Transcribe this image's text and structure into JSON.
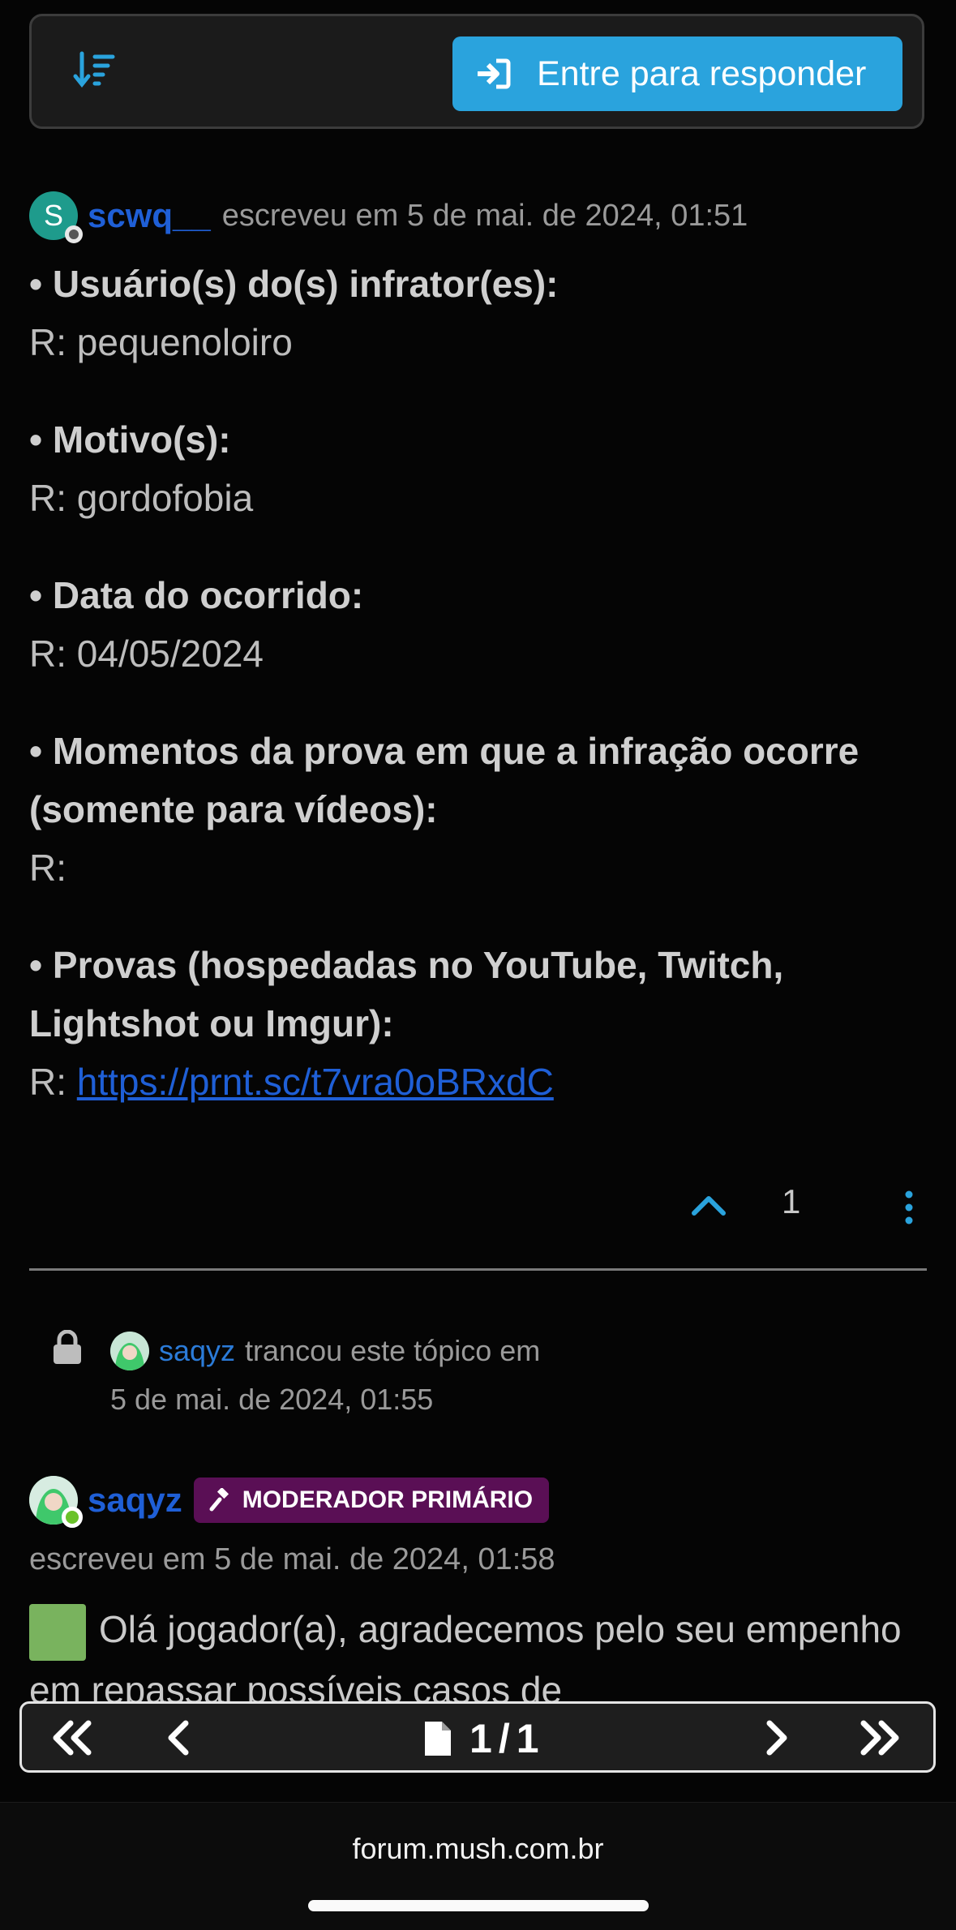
{
  "toolbar": {
    "reply_label": "Entre para responder",
    "sort_icon": "sort-descending-icon",
    "login_icon": "sign-in-icon"
  },
  "post1": {
    "avatar_letter": "S",
    "username": "scwq__",
    "meta": "escreveu em 5 de mai. de 2024, 01:51",
    "items": [
      {
        "q": "• Usuário(s) do(s) infrator(es):",
        "a": "R: pequenoloiro"
      },
      {
        "q": "• Motivo(s):",
        "a": "R: gordofobia"
      },
      {
        "q": "• Data do ocorrido:",
        "a": "R: 04/05/2024"
      },
      {
        "q": "• Momentos da prova em que a infração ocorre (somente para vídeos):",
        "a": "R:"
      },
      {
        "q": "• Provas (hospedadas no YouTube, Twitch, Lightshot ou Imgur):",
        "a_prefix": "R: ",
        "link": "https://prnt.sc/t7vra0oBRxdC"
      }
    ],
    "votes": "1"
  },
  "lock_event": {
    "username": "saqyz",
    "text": "trancou este tópico em",
    "date": "5 de mai. de 2024, 01:55"
  },
  "post2": {
    "username": "saqyz",
    "badge": "MODERADOR PRIMÁRIO",
    "meta": "escreveu em 5 de mai. de 2024, 01:58",
    "text": "Olá jogador(a), agradecemos pelo seu empenho em repassar possíveis casos de"
  },
  "pagination": {
    "current": "1",
    "separator": "/",
    "total": "1"
  },
  "browser": {
    "url": "forum.mush.com.br"
  },
  "colors": {
    "accent": "#2aa3dd",
    "username": "#1f5fd6",
    "badge": "#5a0f55",
    "background": "#050505"
  }
}
